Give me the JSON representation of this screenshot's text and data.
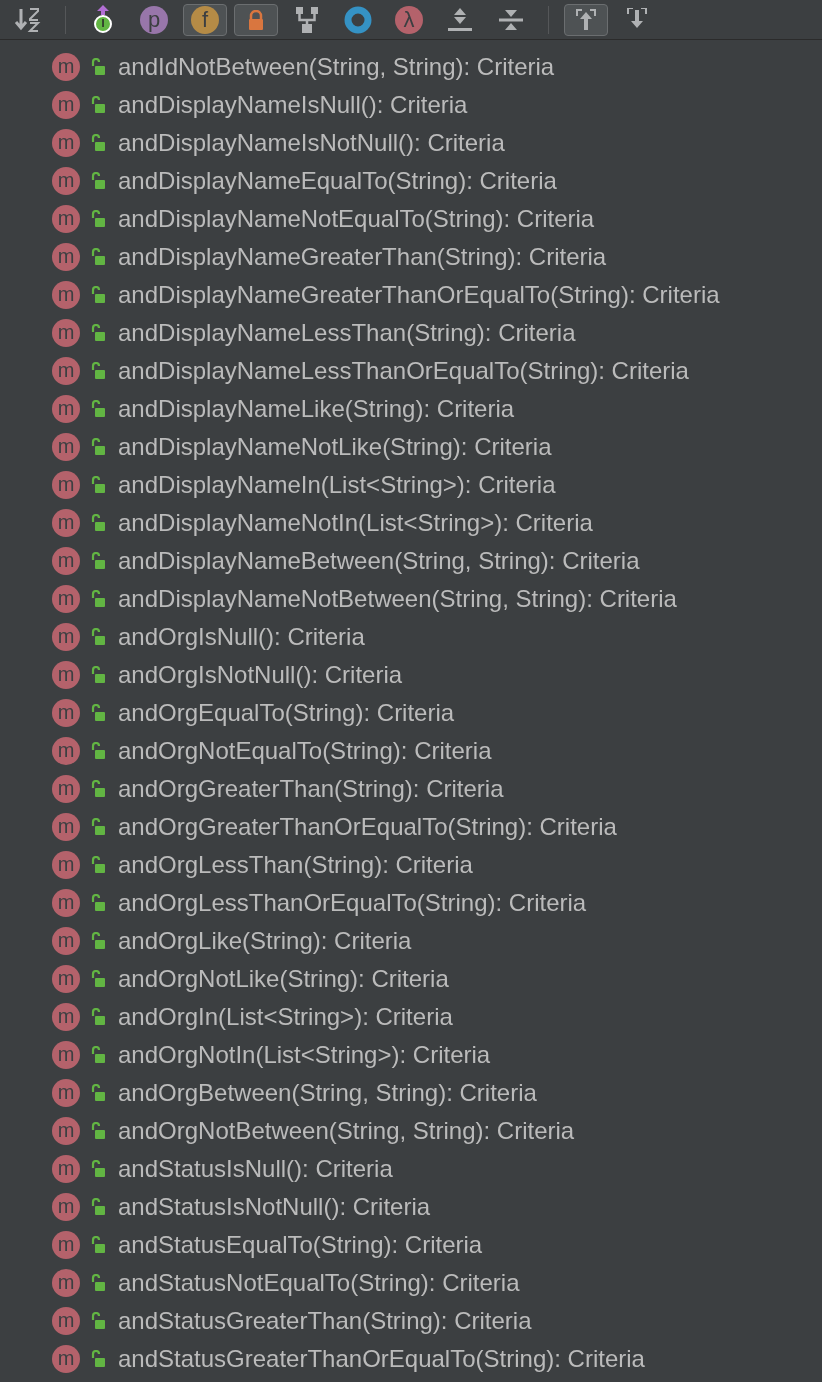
{
  "toolbar": [
    {
      "kind": "sort",
      "selected": false
    },
    {
      "kind": "separator"
    },
    {
      "kind": "inherited",
      "glyph": "I",
      "selected": false
    },
    {
      "kind": "letter",
      "glyph": "p",
      "color": "#9876aa",
      "selected": false
    },
    {
      "kind": "letter",
      "glyph": "f",
      "color": "#b58b46",
      "selected": true
    },
    {
      "kind": "lock",
      "selected": true
    },
    {
      "kind": "hierarchy",
      "selected": false
    },
    {
      "kind": "ring",
      "selected": false
    },
    {
      "kind": "letter",
      "glyph": "λ",
      "color": "#b4626b",
      "selected": false
    },
    {
      "kind": "expand",
      "selected": false
    },
    {
      "kind": "collapse",
      "selected": false
    },
    {
      "kind": "separator"
    },
    {
      "kind": "scroll-from",
      "selected": true
    },
    {
      "kind": "scroll-to",
      "selected": false
    }
  ],
  "members": [
    {
      "glyph": "m",
      "text": "andIdNotBetween(String, String): Criteria"
    },
    {
      "glyph": "m",
      "text": "andDisplayNameIsNull(): Criteria"
    },
    {
      "glyph": "m",
      "text": "andDisplayNameIsNotNull(): Criteria"
    },
    {
      "glyph": "m",
      "text": "andDisplayNameEqualTo(String): Criteria"
    },
    {
      "glyph": "m",
      "text": "andDisplayNameNotEqualTo(String): Criteria"
    },
    {
      "glyph": "m",
      "text": "andDisplayNameGreaterThan(String): Criteria"
    },
    {
      "glyph": "m",
      "text": "andDisplayNameGreaterThanOrEqualTo(String): Criteria"
    },
    {
      "glyph": "m",
      "text": "andDisplayNameLessThan(String): Criteria"
    },
    {
      "glyph": "m",
      "text": "andDisplayNameLessThanOrEqualTo(String): Criteria"
    },
    {
      "glyph": "m",
      "text": "andDisplayNameLike(String): Criteria"
    },
    {
      "glyph": "m",
      "text": "andDisplayNameNotLike(String): Criteria"
    },
    {
      "glyph": "m",
      "text": "andDisplayNameIn(List<String>): Criteria"
    },
    {
      "glyph": "m",
      "text": "andDisplayNameNotIn(List<String>): Criteria"
    },
    {
      "glyph": "m",
      "text": "andDisplayNameBetween(String, String): Criteria"
    },
    {
      "glyph": "m",
      "text": "andDisplayNameNotBetween(String, String): Criteria"
    },
    {
      "glyph": "m",
      "text": "andOrgIsNull(): Criteria"
    },
    {
      "glyph": "m",
      "text": "andOrgIsNotNull(): Criteria"
    },
    {
      "glyph": "m",
      "text": "andOrgEqualTo(String): Criteria"
    },
    {
      "glyph": "m",
      "text": "andOrgNotEqualTo(String): Criteria"
    },
    {
      "glyph": "m",
      "text": "andOrgGreaterThan(String): Criteria"
    },
    {
      "glyph": "m",
      "text": "andOrgGreaterThanOrEqualTo(String): Criteria"
    },
    {
      "glyph": "m",
      "text": "andOrgLessThan(String): Criteria"
    },
    {
      "glyph": "m",
      "text": "andOrgLessThanOrEqualTo(String): Criteria"
    },
    {
      "glyph": "m",
      "text": "andOrgLike(String): Criteria"
    },
    {
      "glyph": "m",
      "text": "andOrgNotLike(String): Criteria"
    },
    {
      "glyph": "m",
      "text": "andOrgIn(List<String>): Criteria"
    },
    {
      "glyph": "m",
      "text": "andOrgNotIn(List<String>): Criteria"
    },
    {
      "glyph": "m",
      "text": "andOrgBetween(String, String): Criteria"
    },
    {
      "glyph": "m",
      "text": "andOrgNotBetween(String, String): Criteria"
    },
    {
      "glyph": "m",
      "text": "andStatusIsNull(): Criteria"
    },
    {
      "glyph": "m",
      "text": "andStatusIsNotNull(): Criteria"
    },
    {
      "glyph": "m",
      "text": "andStatusEqualTo(String): Criteria"
    },
    {
      "glyph": "m",
      "text": "andStatusNotEqualTo(String): Criteria"
    },
    {
      "glyph": "m",
      "text": "andStatusGreaterThan(String): Criteria"
    },
    {
      "glyph": "m",
      "text": "andStatusGreaterThanOrEqualTo(String): Criteria"
    }
  ]
}
